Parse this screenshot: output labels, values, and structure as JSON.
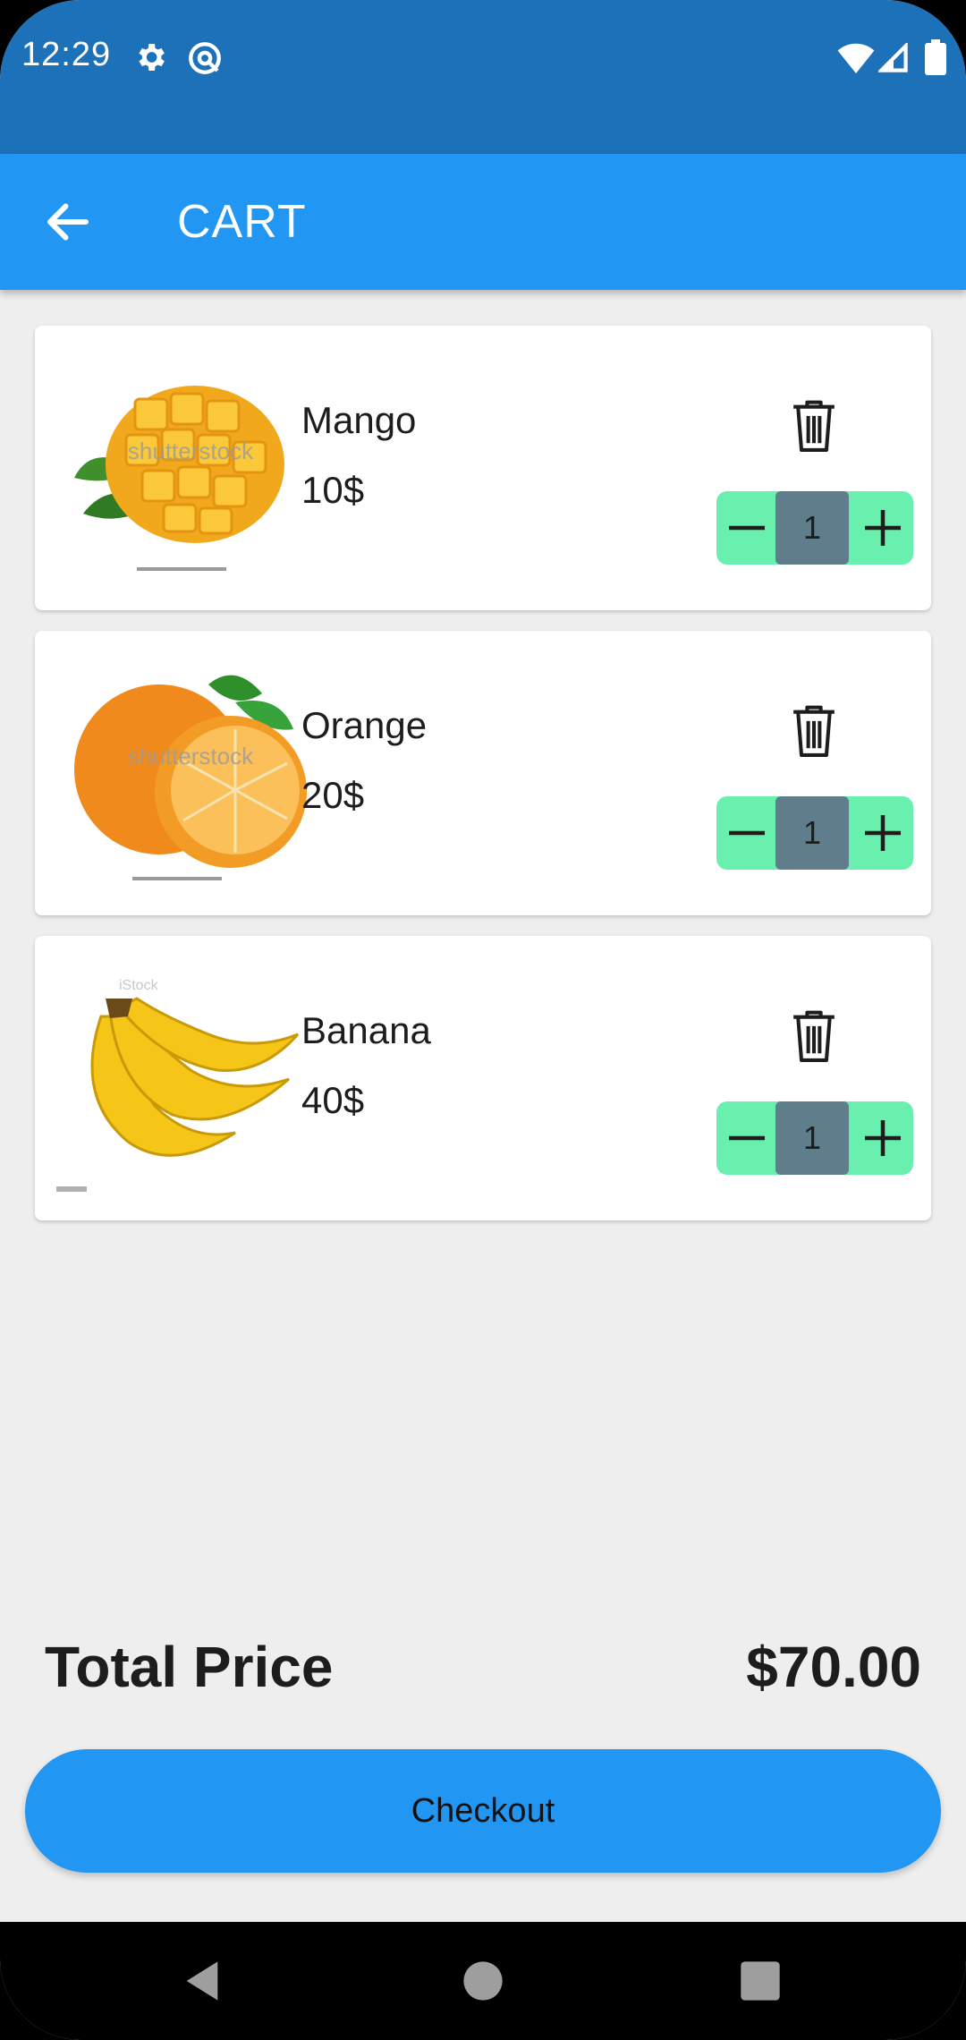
{
  "status_bar": {
    "time": "12:29",
    "icons": [
      "gear-icon",
      "at-sign-icon",
      "wifi-icon",
      "signal-icon",
      "battery-icon"
    ]
  },
  "app_bar": {
    "title": "CART",
    "back_icon": "arrow-back-icon"
  },
  "cart": {
    "items": [
      {
        "name": "Mango",
        "price": "10$",
        "quantity": "1",
        "image": "mango-image",
        "watermark": "shutterstock"
      },
      {
        "name": "Orange",
        "price": "20$",
        "quantity": "1",
        "image": "orange-image",
        "watermark": "shutterstock"
      },
      {
        "name": "Banana",
        "price": "40$",
        "quantity": "1",
        "image": "banana-image",
        "watermark": "iStock"
      }
    ]
  },
  "summary": {
    "total_label": "Total Price",
    "total_value": "$70.00",
    "checkout_label": "Checkout"
  },
  "colors": {
    "status_bar": "#1d71b8",
    "app_bar": "#2196f3",
    "stepper": "#69f0ae",
    "quantity_box": "#607d8b",
    "background": "#eeeeee"
  }
}
